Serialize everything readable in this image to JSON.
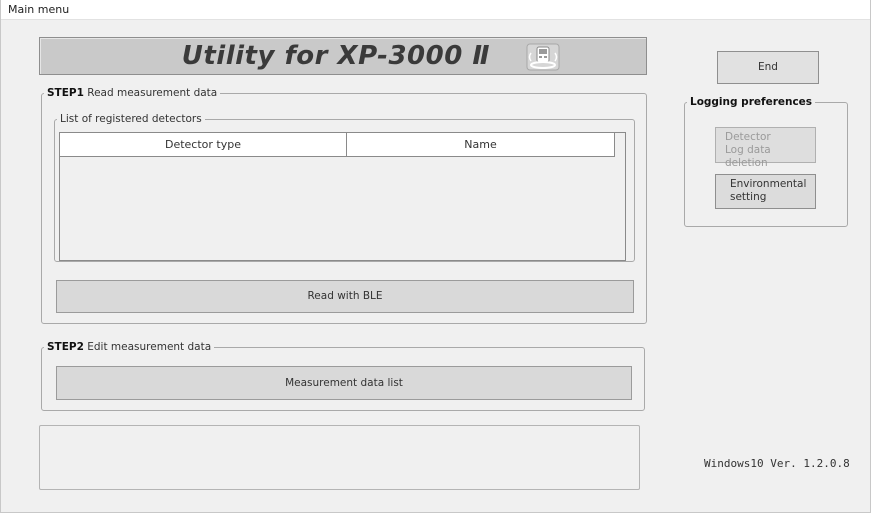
{
  "window": {
    "title": "Main menu"
  },
  "banner": {
    "title": "Utility for XP-3000 Ⅱ",
    "icon": "device-icon"
  },
  "step1": {
    "legend_step": "STEP1",
    "legend_text": "Read measurement data",
    "registered": {
      "legend": "List of registered detectors",
      "columns": [
        "Detector type",
        "Name"
      ],
      "rows": []
    },
    "read_button": "Read with BLE"
  },
  "step2": {
    "legend_step": "STEP2",
    "legend_text": "Edit measurement data",
    "list_button": "Measurement data list"
  },
  "end_button": "End",
  "logging": {
    "legend": "Logging preferences",
    "detector_delete_line1": "Detector",
    "detector_delete_line2": "Log data deletion",
    "env_setting_line1": "Environmental",
    "env_setting_line2": "setting"
  },
  "message": "",
  "version": "Windows10 Ver. 1.2.0.8"
}
